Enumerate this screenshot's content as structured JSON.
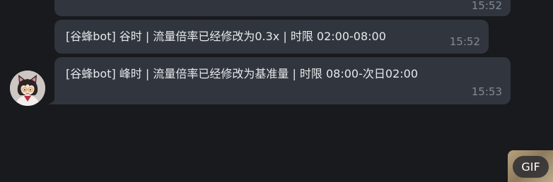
{
  "messages": [
    {
      "text": "",
      "time": "15:52"
    },
    {
      "text": "[谷蜂bot] 谷时 | 流量倍率已经修改为0.3x | 时限 02:00-08:00",
      "time": "15:52"
    },
    {
      "text": "[谷蜂bot] 峰时 | 流量倍率已经修改为基准量 | 时限 08:00-次日02:00",
      "time": "15:53"
    }
  ],
  "gif_badge": "GIF",
  "colors": {
    "background": "#181a1e",
    "bubble": "#31363e",
    "text": "#e6e8eb",
    "time": "#828a95"
  },
  "icons": {
    "avatar": "cat-ear-girl-avatar",
    "gif": "gif-thumbnail"
  }
}
